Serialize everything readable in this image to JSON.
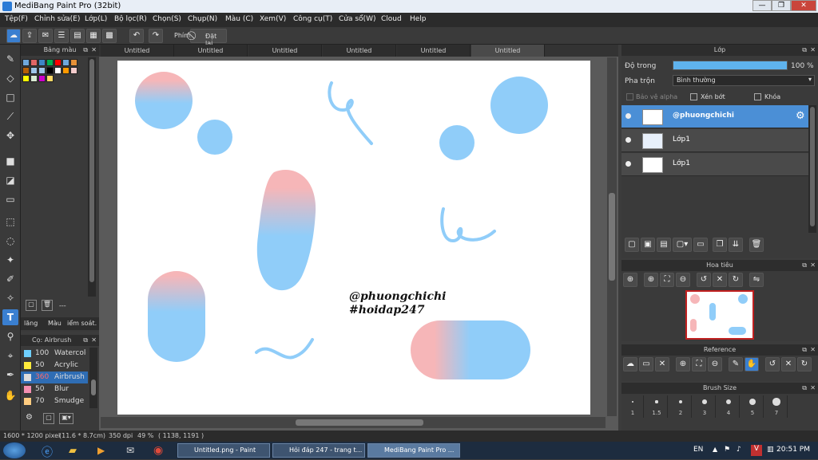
{
  "window": {
    "title": "MediBang Paint Pro (32bit)"
  },
  "menu": [
    "Tệp(F)",
    "Chỉnh sửa(E)",
    "Lớp(L)",
    "Bộ lọc(R)",
    "Chọn(S)",
    "Chụp(N)",
    "Màu (C)",
    "Xem(V)",
    "Công cụ(T)",
    "Cửa sổ(W)",
    "Cloud",
    "Help"
  ],
  "toolbar": {
    "snap_label": "Phím",
    "reset_label": "Đặt lại"
  },
  "tabs": [
    "Untitled",
    "Untitled",
    "Untitled",
    "Untitled",
    "Untitled",
    "Untitled"
  ],
  "palette_panel": {
    "title": "Bảng màu",
    "count": "---",
    "tabs": [
      "lăng",
      "Màu",
      "iểm soát."
    ]
  },
  "palette_colors": [
    "#6fa8dc",
    "#e06666",
    "#3d85c6",
    "#00b050",
    "#ff0000",
    "#6fa8dc",
    "#e69138",
    "#b45f06",
    "#9fc5e8",
    "#9fc5e8",
    "#000000",
    "#ffffff",
    "#ff9900",
    "#f4cccc",
    "#ffff00",
    "#d9ead3",
    "#cc00cc",
    "#ffd966"
  ],
  "brush_panel": {
    "title": "Cọ: Airbrush",
    "brushes": [
      {
        "size": "100",
        "name": "Watercolor",
        "color": "#6fd0ff"
      },
      {
        "size": "50",
        "name": "Acrylic",
        "color": "#ffeb3b"
      },
      {
        "size": "360",
        "name": "Airbrush",
        "color": "#dddddd"
      },
      {
        "size": "50",
        "name": "Blur",
        "color": "#f48fb1"
      },
      {
        "size": "70",
        "name": "Smudge",
        "color": "#ffcc80"
      }
    ]
  },
  "layers_panel": {
    "title": "Lớp",
    "opacity_label": "Độ trong",
    "opacity_value": "100 %",
    "opacity_fraction": 1.0,
    "blend_label": "Pha trộn",
    "blend_value": "Bình thường",
    "protect_alpha": "Bảo vệ alpha",
    "clipping": "Xén bớt",
    "lock": "Khóa",
    "layers": [
      {
        "name": "@phuongchichi",
        "selected": true
      },
      {
        "name": "Lớp1",
        "selected": false
      },
      {
        "name": "Lớp1",
        "selected": false
      }
    ]
  },
  "navigator_panel": {
    "title": "Hoa tiêu"
  },
  "reference_panel": {
    "title": "Reference"
  },
  "brushsize_panel": {
    "title": "Brush Size",
    "sizes": [
      "1",
      "1.5",
      "2",
      "3",
      "4",
      "5",
      "7"
    ]
  },
  "canvas": {
    "text_line1": "@phuongchichi",
    "text_line2": "#hoidap247"
  },
  "status": {
    "dims": "1600 * 1200 pixel",
    "physical": "(11.6 * 8.7cm)",
    "dpi": "350 dpi",
    "zoom": "49 %",
    "cursor": "( 1138, 1191 )"
  },
  "taskbar": {
    "tasks": [
      "Untitled.png - Paint",
      "Hỏi đáp 247 - trang t...",
      "MediBang Paint Pro ..."
    ],
    "lang": "EN",
    "time": "20:51 PM"
  }
}
